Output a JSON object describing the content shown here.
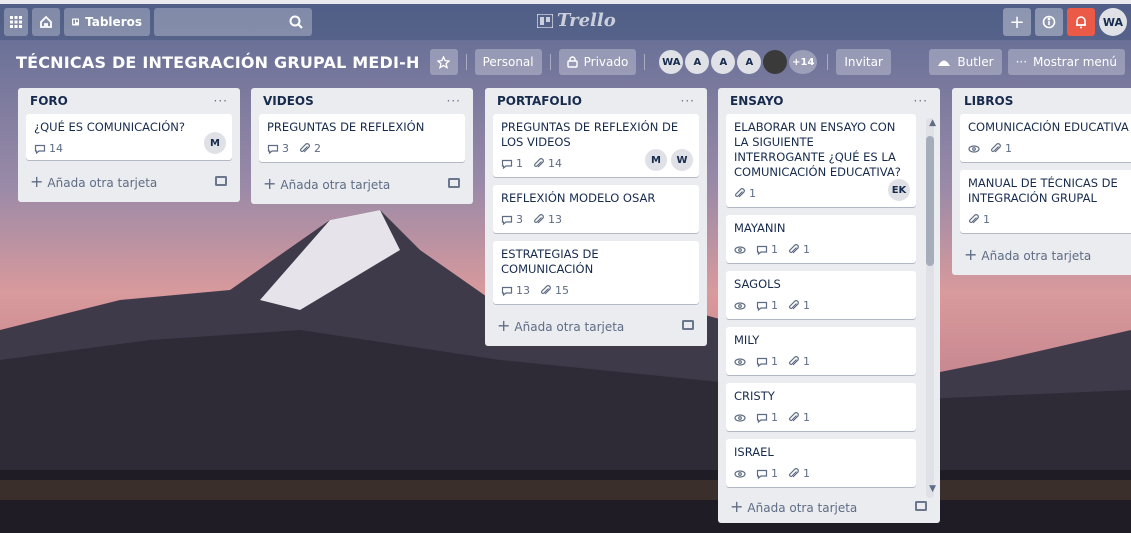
{
  "header": {
    "boards_label": "Tableros",
    "search_placeholder": "",
    "logo_text": "Trello",
    "user_initials": "WA"
  },
  "board": {
    "title": "TÉCNICAS DE INTEGRACIÓN GRUPAL MEDI-H",
    "team_label": "Personal",
    "visibility_label": "Privado",
    "members": [
      "WA",
      "A",
      "A",
      "A"
    ],
    "more_members": "+14",
    "invite_label": "Invitar",
    "butler_label": "Butler",
    "menu_label": "Mostrar menú"
  },
  "add_card_label": "Añada otra tarjeta",
  "lists": [
    {
      "title": "FORO",
      "cards": [
        {
          "title": "¿QUÉ ES COMUNICACIÓN?",
          "comments": "14",
          "members": [
            "M"
          ]
        }
      ]
    },
    {
      "title": "VIDEOS",
      "cards": [
        {
          "title": "PREGUNTAS DE REFLEXIÓN",
          "comments": "3",
          "attachments": "2"
        }
      ]
    },
    {
      "title": "PORTAFOLIO",
      "cards": [
        {
          "title": "PREGUNTAS DE REFLEXIÓN DE LOS VIDEOS",
          "comments": "1",
          "attachments": "14",
          "members": [
            "M",
            "W"
          ]
        },
        {
          "title": "REFLEXIÓN MODELO OSAR",
          "comments": "3",
          "attachments": "13"
        },
        {
          "title": "ESTRATEGIAS DE COMUNICACIÓN",
          "comments": "13",
          "attachments": "15"
        }
      ]
    },
    {
      "title": "ENSAYO",
      "cards": [
        {
          "title": "ELABORAR UN ENSAYO CON LA SIGUIENTE INTERROGANTE ¿QUÉ ES LA COMUNICACIÓN EDUCATIVA?",
          "attachments": "1",
          "members": [
            "EK"
          ]
        },
        {
          "title": "MAYANIN",
          "comments": "1",
          "attachments": "1"
        },
        {
          "title": "SAGOLS",
          "comments": "1",
          "attachments": "1"
        },
        {
          "title": "MILY",
          "comments": "1",
          "attachments": "1"
        },
        {
          "title": "CRISTY",
          "comments": "1",
          "attachments": "1"
        },
        {
          "title": "ISRAEL",
          "comments": "1",
          "attachments": "1"
        }
      ]
    },
    {
      "title": "LIBROS",
      "cards": [
        {
          "title": "COMUNICACIÓN EDUCATIVA",
          "attachments": "1"
        },
        {
          "title": "MANUAL DE TÉCNICAS DE INTEGRACIÓN GRUPAL",
          "attachments": "1"
        }
      ]
    }
  ],
  "colors": {
    "header_bg": "#46557d",
    "list_bg": "#ebecf0",
    "bell": "#eb5a46",
    "text": "#172b4d"
  }
}
